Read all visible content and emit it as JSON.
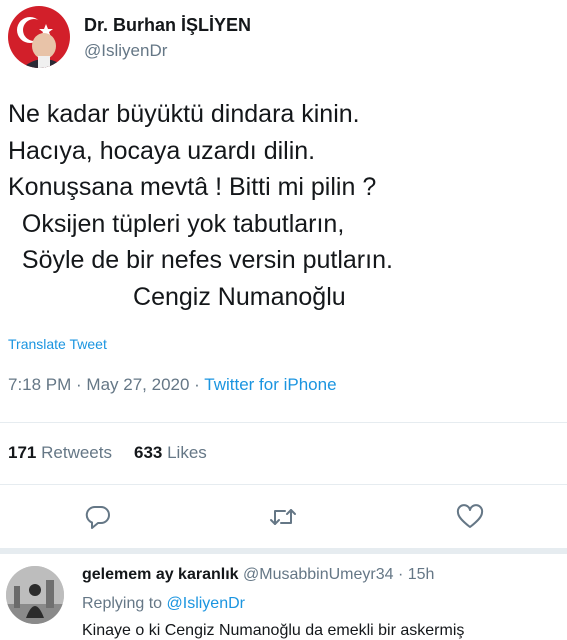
{
  "author": {
    "name": "Dr. Burhan İŞLİYEN",
    "handle": "@IsliyenDr"
  },
  "tweet": {
    "lines": [
      "Ne kadar büyüktü dindara kinin.",
      "Hacıya, hocaya uzardı dilin.",
      "Konuşsana mevtâ ! Bitti mi pilin ?",
      "  Oksijen tüpleri yok tabutların,",
      "  Söyle de bir nefes versin putların.",
      "                  Cengiz Numanoğlu"
    ],
    "translate_label": "Translate Tweet",
    "time": "7:18 PM",
    "sep": " · ",
    "date": "May 27, 2020",
    "sep2": " · ",
    "source": "Twitter for iPhone"
  },
  "stats": {
    "retweets_count": "171",
    "retweets_label": "Retweets",
    "likes_count": "633",
    "likes_label": "Likes"
  },
  "actions": {
    "reply_icon": "reply-icon",
    "retweet_icon": "retweet-icon",
    "like_icon": "heart-icon",
    "accent": "#657786"
  },
  "reply": {
    "name": "gelemem ay karanlık",
    "handle": "@MusabbinUmeyr34",
    "sep": " · ",
    "age": "15h",
    "replying_prefix": "Replying to",
    "replying_to": "@IsliyenDr",
    "text": "Kinaye o ki Cengiz Numanoğlu da emekli bir askermiş"
  },
  "colors": {
    "link": "#1b95e0",
    "muted": "#657786",
    "text": "#14171a"
  }
}
